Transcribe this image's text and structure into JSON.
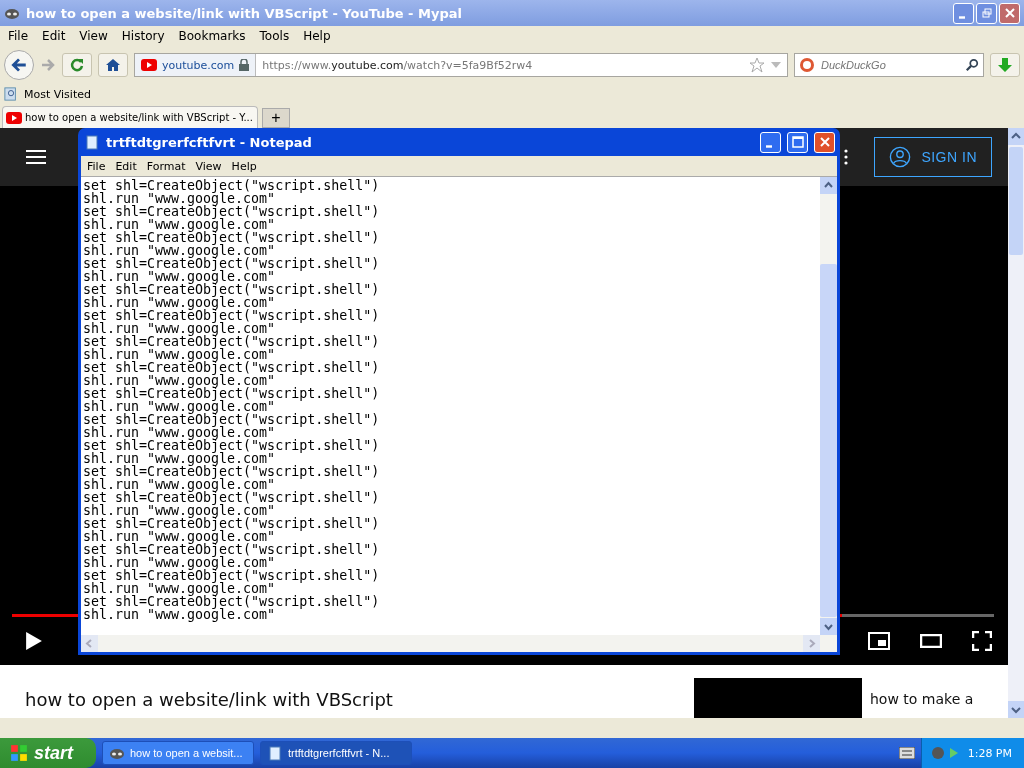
{
  "browser": {
    "title": "how to open a website/link with VBScript - YouTube - Mypal",
    "menu": [
      "File",
      "Edit",
      "View",
      "History",
      "Bookmarks",
      "Tools",
      "Help"
    ],
    "site_label": "youtube.com",
    "url": {
      "muted_start": "https://www.",
      "host": "youtube.com",
      "path": "/watch?v=5fa9Bf52rw4"
    },
    "search": {
      "placeholder": "DuckDuckGo"
    },
    "bookmarks": [
      "Most Visited"
    ],
    "tabs": [
      {
        "label": "how to open a website/link with VBScript - Y...",
        "selected": true
      }
    ],
    "new_tab": "+"
  },
  "youtube": {
    "sign_in": "SIGN IN",
    "progress": {
      "level": 0.845
    },
    "video_title": "how to open a website/link with VBScript",
    "related_title": "how to make a"
  },
  "notepad": {
    "title": "trtftdtgrerfcftfvrt - Notepad",
    "menu": [
      "File",
      "Edit",
      "Format",
      "View",
      "Help"
    ],
    "lines": [
      "set shl=CreateObject(\"wscript.shell\")",
      "shl.run \"www.google.com\"",
      "set shl=CreateObject(\"wscript.shell\")",
      "shl.run \"www.google.com\"",
      "set shl=CreateObject(\"wscript.shell\")",
      "shl.run \"www.google.com\"",
      "set shl=CreateObject(\"wscript.shell\")",
      "shl.run \"www.google.com\"",
      "set shl=CreateObject(\"wscript.shell\")",
      "shl.run \"www.google.com\"",
      "set shl=CreateObject(\"wscript.shell\")",
      "shl.run \"www.google.com\"",
      "set shl=CreateObject(\"wscript.shell\")",
      "shl.run \"www.google.com\"",
      "set shl=CreateObject(\"wscript.shell\")",
      "shl.run \"www.google.com\"",
      "set shl=CreateObject(\"wscript.shell\")",
      "shl.run \"www.google.com\"",
      "set shl=CreateObject(\"wscript.shell\")",
      "shl.run \"www.google.com\"",
      "set shl=CreateObject(\"wscript.shell\")",
      "shl.run \"www.google.com\"",
      "set shl=CreateObject(\"wscript.shell\")",
      "shl.run \"www.google.com\"",
      "set shl=CreateObject(\"wscript.shell\")",
      "shl.run \"www.google.com\"",
      "set shl=CreateObject(\"wscript.shell\")",
      "shl.run \"www.google.com\"",
      "set shl=CreateObject(\"wscript.shell\")",
      "shl.run \"www.google.com\"",
      "set shl=CreateObject(\"wscript.shell\")",
      "shl.run \"www.google.com\"",
      "set shl=CreateObject(\"wscript.shell\")",
      "shl.run \"www.google.com\""
    ]
  },
  "taskbar": {
    "start": "start",
    "tasks": [
      {
        "label": "how to open a websit...",
        "kind": "browser",
        "selected": false
      },
      {
        "label": "trtftdtgrerfcftfvrt - N...",
        "kind": "notepad",
        "selected": true
      }
    ],
    "clock": "1:28 PM"
  }
}
